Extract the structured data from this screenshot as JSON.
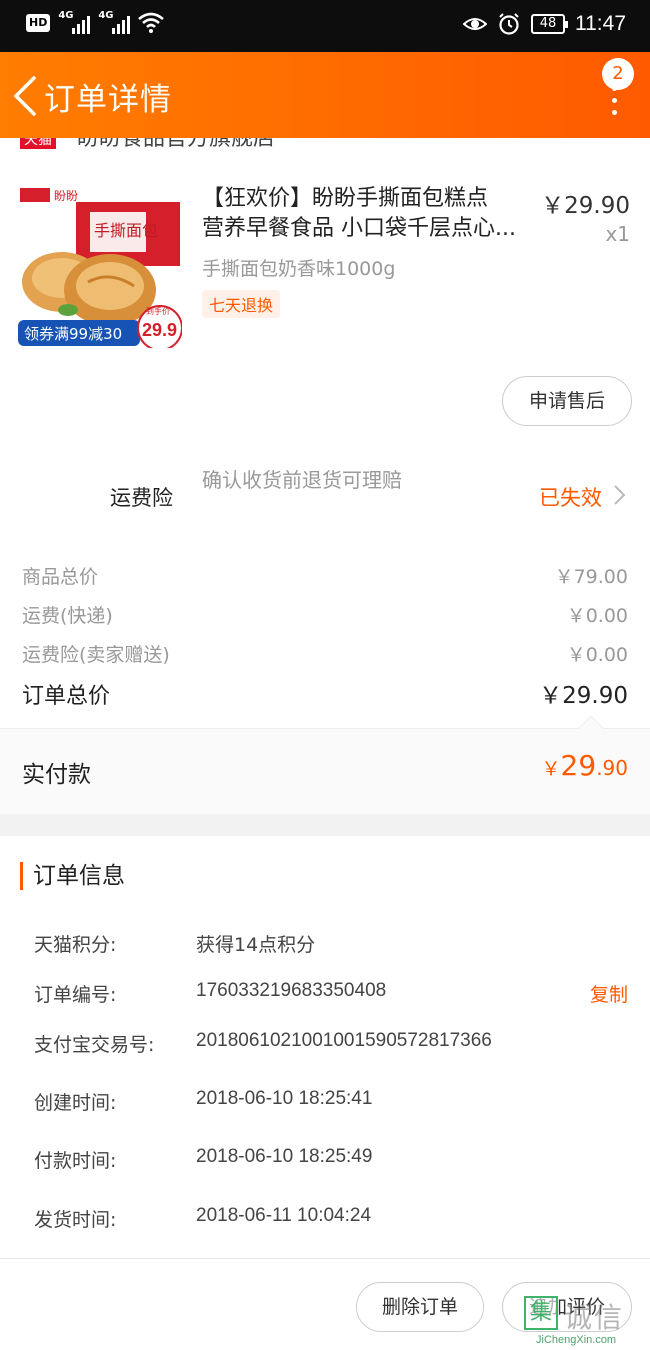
{
  "status_bar": {
    "hd": "HD",
    "net1": "4G",
    "net2": "4G",
    "battery": "48",
    "time": "11:47",
    "icons": [
      "eye-icon",
      "alarm-icon",
      "wifi-icon",
      "signal-icon"
    ]
  },
  "header": {
    "title": "订单详情",
    "badge_count": "2",
    "background": "#ff6a00"
  },
  "store": {
    "tag": "天猫",
    "name": "盼盼食品官方旗舰店"
  },
  "product": {
    "title_line1": "【狂欢价】盼盼手撕面包糕点",
    "title_line2": "营养早餐食品 小口袋千层点心...",
    "price": "￥29.90",
    "quantity": "x1",
    "spec": "手撕面包奶香味1000g",
    "tag": "七天退换",
    "image_texts": {
      "brand": "盼盼",
      "box": "手撕面包",
      "coupon": "领券满99减30",
      "price": "29.9",
      "price_label": "到手价"
    }
  },
  "after_sale_button": "申请售后",
  "insurance": {
    "label": "运费险",
    "description": "确认收货前退货可理赔",
    "status": "已失效"
  },
  "price_rows": [
    {
      "label": "商品总价",
      "value": "￥79.00"
    },
    {
      "label": "运费(快递)",
      "value": "￥0.00"
    },
    {
      "label": "运费险(卖家赠送)",
      "value": "￥0.00"
    }
  ],
  "order_total": {
    "label": "订单总价",
    "value": "￥29.90"
  },
  "paid": {
    "label": "实付款",
    "currency": "￥",
    "integer": "29",
    "decimal": ".90"
  },
  "order_info": {
    "title": "订单信息",
    "rows": [
      {
        "label": "天猫积分:",
        "value": "获得14点积分"
      },
      {
        "label": "订单编号:",
        "value": "176033219683350408"
      },
      {
        "label": "支付宝交易号:",
        "value": "2018061021001001590572817366"
      },
      {
        "label": "创建时间:",
        "value": "2018-06-10 18:25:41"
      },
      {
        "label": "付款时间:",
        "value": "2018-06-10 18:25:49"
      },
      {
        "label": "发货时间:",
        "value": "2018-06-11 10:04:24"
      }
    ],
    "copy_label": "复制"
  },
  "footer_buttons": {
    "delete": "删除订单",
    "review": "追加评价"
  },
  "watermark": {
    "mark": "集",
    "cn": "诚信",
    "en": "JiChengXin.com"
  },
  "colors": {
    "accent": "#ff5a00",
    "header_start": "#ff7d00",
    "header_end": "#ff5a00"
  }
}
